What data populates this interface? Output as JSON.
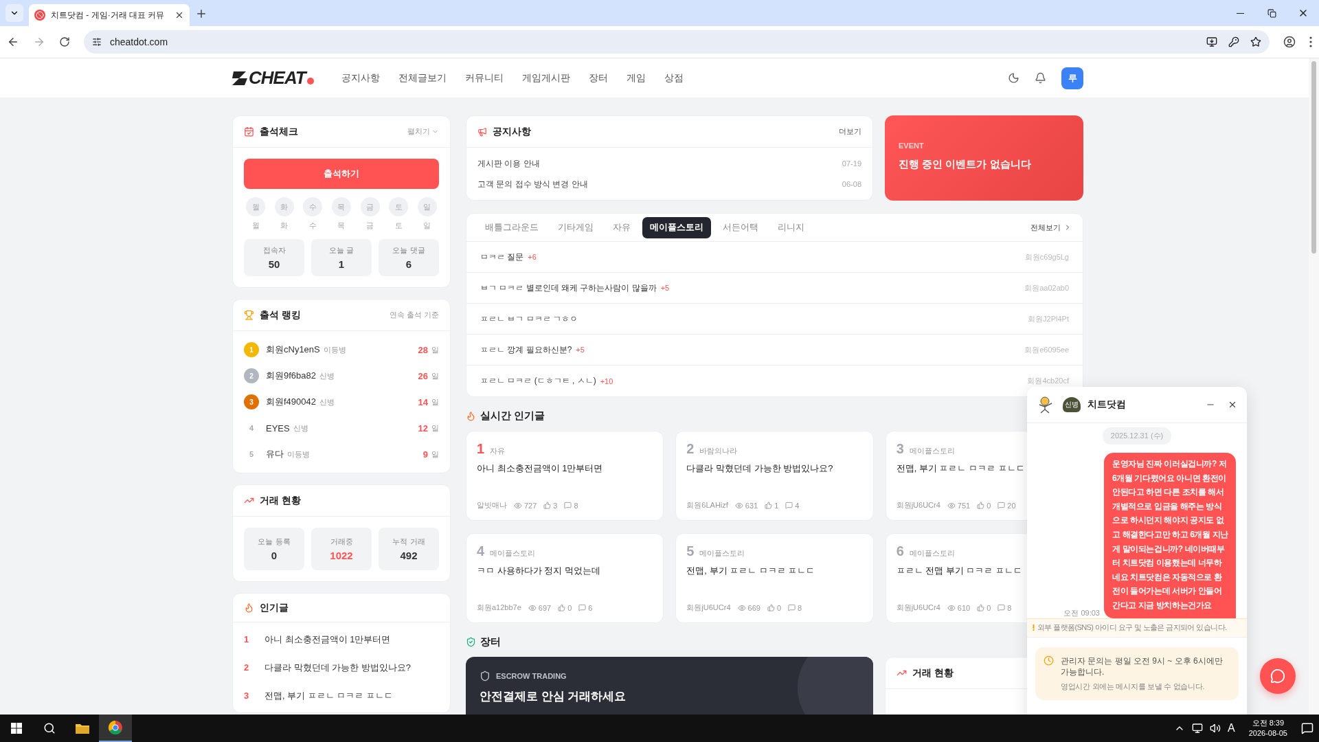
{
  "browser": {
    "tab_title": "치트닷컴 - 게임·거래 대표 커뮤",
    "url": "cheatdot.com"
  },
  "header": {
    "logo": "CHEAT",
    "nav": [
      "공지사항",
      "전체글보기",
      "커뮤니티",
      "게임게시판",
      "장터",
      "게임",
      "상점"
    ],
    "avatar": "루"
  },
  "attendance": {
    "title": "출석체크",
    "toggle": "펼치기",
    "button": "출석하기",
    "days": [
      {
        "circle": "월",
        "label": "월",
        "checked": false
      },
      {
        "circle": "화",
        "label": "화",
        "checked": false
      },
      {
        "circle": "수",
        "label": "수",
        "checked": false
      },
      {
        "circle": "목",
        "label": "목",
        "checked": false
      },
      {
        "circle": "금",
        "label": "금",
        "checked": false
      },
      {
        "circle": "토",
        "label": "토",
        "checked": false
      },
      {
        "circle": "일",
        "label": "일",
        "checked": false
      }
    ],
    "stats": [
      {
        "label": "접속자",
        "value": "50"
      },
      {
        "label": "오늘 글",
        "value": "1"
      },
      {
        "label": "오늘 댓글",
        "value": "6"
      }
    ]
  },
  "ranking": {
    "title": "출석 랭킹",
    "note": "연속 출석 기준",
    "rows": [
      {
        "rank": "1",
        "kind": "gold",
        "name": "회원cNy1enS",
        "grade": "이등병",
        "days": "28",
        "unit": "일"
      },
      {
        "rank": "2",
        "kind": "silver",
        "name": "회원9f6ba82",
        "grade": "신병",
        "days": "26",
        "unit": "일"
      },
      {
        "rank": "3",
        "kind": "bronze",
        "name": "회원f490042",
        "grade": "신병",
        "days": "14",
        "unit": "일"
      },
      {
        "rank": "4",
        "kind": "plain",
        "name": "EYES",
        "grade": "신병",
        "days": "12",
        "unit": "일"
      },
      {
        "rank": "5",
        "kind": "plain",
        "name": "유다",
        "grade": "이등병",
        "days": "9",
        "unit": "일"
      }
    ]
  },
  "trade_stats": {
    "title": "거래 현황",
    "stats": [
      {
        "label": "오늘 등록",
        "value": "0",
        "highlight": false
      },
      {
        "label": "거래중",
        "value": "1022",
        "highlight": true
      },
      {
        "label": "누적 거래",
        "value": "492",
        "highlight": false
      }
    ]
  },
  "popular": {
    "title": "인기글",
    "items": [
      {
        "rank": "1",
        "text": "아니 최소충전금액이 1만부터면"
      },
      {
        "rank": "2",
        "text": "다클라 막혔던데 가능한 방법있나요?"
      },
      {
        "rank": "3",
        "text": "전맵, 부기 ㅍㄹㄴ ㅁㅋㄹ ㅍㄴㄷ"
      }
    ]
  },
  "notice": {
    "title": "공지사항",
    "more": "더보기",
    "items": [
      {
        "title": "게시판 이용 안내",
        "date": "07-19"
      },
      {
        "title": "고객 문의 접수 방식 변경 안내",
        "date": "06-08"
      }
    ]
  },
  "event": {
    "tag": "EVENT",
    "text": "진행 중인 이벤트가 없습니다"
  },
  "board": {
    "tabs": [
      {
        "label": "배틀그라운드",
        "selected": false
      },
      {
        "label": "기타게임",
        "selected": false
      },
      {
        "label": "자유",
        "selected": false
      },
      {
        "label": "메이플스토리",
        "selected": true
      },
      {
        "label": "서든어택",
        "selected": false
      },
      {
        "label": "리니지",
        "selected": false
      }
    ],
    "all": "전체보기",
    "posts": [
      {
        "title": "ㅁㅋㄹ 질문",
        "comments": "+6",
        "author": "회원c69g5Lg"
      },
      {
        "title": "ㅂㄱ ㅁㅋㄹ 별로인데 왜케 구하는사람이 많을까",
        "comments": "+5",
        "author": "회원aa02ab0"
      },
      {
        "title": "ㅍㄹㄴ ㅂㄱ ㅁㅋㄹ ㄱㅎㅇ",
        "author": "회원J2Pl4Pt"
      },
      {
        "title": "ㅍㄹㄴ 깡계 필요하신분?",
        "comments": "+5",
        "author": "회원e6095ee"
      },
      {
        "title": "ㅍㄹㄴ ㅁㅋㄹ (ㄷㅎㄱㅌ , ㅅㄴ)",
        "comments": "+10",
        "author": "회원4cb20cf"
      }
    ]
  },
  "realtime": {
    "title": "실시간 인기글",
    "cards": [
      {
        "rank": "1",
        "hot": true,
        "category": "자유",
        "title": "아니 최소충전금액이 1만부터면",
        "author": "알빗매나",
        "views": "727",
        "likes": "3",
        "comments": "8"
      },
      {
        "rank": "2",
        "hot": false,
        "category": "바람의나라",
        "title": "다클라 막혔던데 가능한 방법있나요?",
        "author": "회원6LAHizf",
        "views": "631",
        "likes": "1",
        "comments": "4"
      },
      {
        "rank": "3",
        "hot": false,
        "category": "메이플스토리",
        "title": "전맵, 부기 ㅍㄹㄴ ㅁㅋㄹ ㅍㄴㄷ",
        "author": "회원jU6UCr4",
        "views": "751",
        "likes": "0",
        "comments": "20"
      },
      {
        "rank": "4",
        "hot": false,
        "category": "메이플스토리",
        "title": "ㅋㅁ 사용하다가 정지 먹었는데",
        "author": "회원a12bb7e",
        "views": "697",
        "likes": "0",
        "comments": "6"
      },
      {
        "rank": "5",
        "hot": false,
        "category": "메이플스토리",
        "title": "전맵, 부기 ㅍㄹㄴ ㅁㅋㄹ ㅍㄴㄷ",
        "author": "회원jU6UCr4",
        "views": "669",
        "likes": "0",
        "comments": "8"
      },
      {
        "rank": "6",
        "hot": false,
        "category": "메이플스토리",
        "title": "ㅍㄹㄴ 전맵 부기 ㅁㅋㄹ ㅍㄴㄷ",
        "author": "회원jU6UCr4",
        "views": "610",
        "likes": "0",
        "comments": "8"
      }
    ]
  },
  "market": {
    "title": "장터",
    "banner_tag": "ESCROW TRADING",
    "banner_title": "안전결제로 안심 거래하세요",
    "trade_title": "거래 현황"
  },
  "chat": {
    "title": "치트닷컴",
    "badge": "신병",
    "date": "2025.12.31 (수)",
    "messages": [
      {
        "time": "오전 09:03",
        "text": "운영자님 진짜 이러실겁니까? 저 6개월 기다렸어요 아니면 환전이 안된다고 하면 다른 조치를 해서 개별적으로 입금을 해주는 방식으로 하시던지 해야지 공지도 없고 해결한다고만 하고 6개월 지난게 말이되는겁니까? 네이버때부터 치트닷컴 이용했는데 너무하네요 치트닷컴은 자동적으로 환전이 들어가는데 서버가 안들어간다고 지금 방치하는건가요"
      }
    ],
    "warning": "외부 플랫폼(SNS) 아이디 요구 및 노출은 금지되어 있습니다.",
    "hours": "관리자 문의는 평일 오전 9시 ~ 오후 6시에만 가능합니다.",
    "hours_sub": "영업시간 외에는 메시지를 보낼 수 없습니다."
  },
  "taskbar": {
    "ime": "A",
    "time": "오전 8:39",
    "date": "2026-08-05"
  }
}
